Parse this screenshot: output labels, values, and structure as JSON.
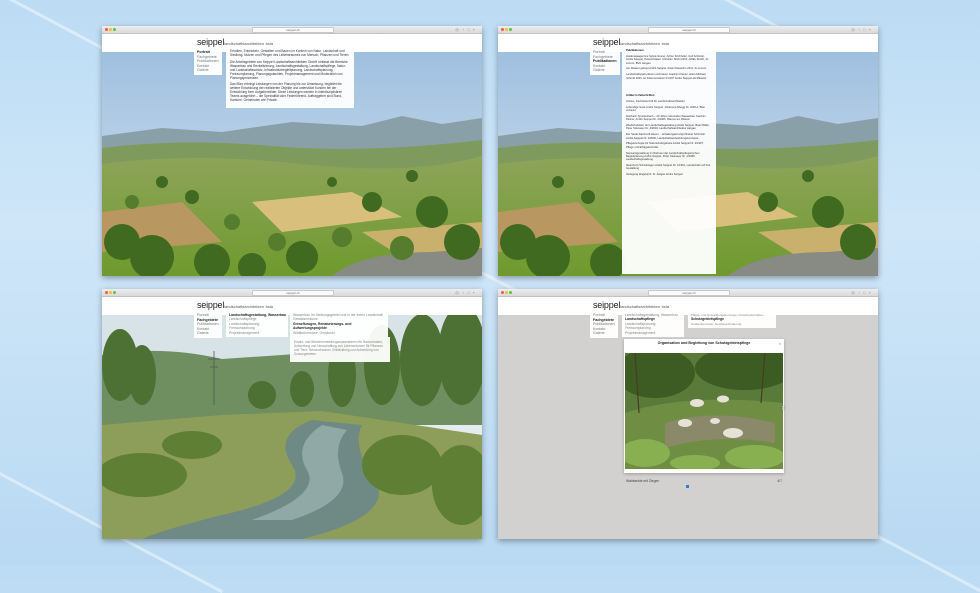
{
  "browser": {
    "url": "seippel.ch",
    "toolbar_icons": "◎ ↑ □ +",
    "nav_buttons": "‹ › ▢"
  },
  "logo": {
    "brand": "seippel",
    "name": "landschaftsarchitekten",
    "suffix": "bsla"
  },
  "nav": {
    "items": [
      "Portrait",
      "Fachgebiete",
      "Publikationen",
      "Kontakt",
      "Galerie"
    ]
  },
  "window1": {
    "paragraphs": [
      "Erhalten, Entwickeln, Gestalten und Bauen im Kontext von Natur, Landschaft und Siedlung. Nutzen und Pflegen des Lebensraumes von Mensch, Pflanzen und Tieren.",
      "Die Arbeitsgebiete von Seippel Landschaftsarchitekten GmbH umfasst die Bereiche Wasserbau und Revitalisierung, Landschaftsgestaltung, Landschaftspflege, Natur- und Landschaftsschutz, Infrastrukturbegleitplanung, Landschaftsplanung, Freiraumplanung, Planungsgutachten, Projektmanagement und Moderation von Planungsprozessen.",
      "Das Büro erbringt Leistungen von der Planung bis zur Umsetzung, begleitet die weitere Entwicklung der realisierten Objekte und unterstützt Kunden bei der Entwicklung ihrer Aufgabenbilder. Diese Leistungen werden in interdisziplinären Teams ausgeführt – die Spezialität oder Federführend, Auftraggeber sind Bund, Kantone, Gemeinden wie Private."
    ]
  },
  "window2": {
    "heading": "Publikationen",
    "entries": [
      "Heidenwaagerinne Sylvia Gruner, Arthur Kirchhofer, Ueli Schöntin, Andre Seippel, Pascal Kaiser, Christian Teicht 2014, AWEL Zürich, IH Luzern, BVU Aargau",
      "Am Wasser geboul André Seippel, Karin Passerino 2011, IH Luzern",
      "Landschaftspark planen und bauen Joachim Kleiner, Hans-Michael Schmitt 2001, so Dokumentation D 0167 André Seippel als Mitautor",
      "Artikel in Zeitschriften",
      "Anthos, Fachzeitschrift für Landschaftsarchitektur",
      "Lebendige Suse André Seippel, Johannes Albegg Nr. 3/2014, Blau verrannt",
      "Dorfbach Spreitenbach – 20 Jahre naturnaher Wasserbau Joachim Kleiner, André Seippel Nr. 2/2006, Räume am Wasser",
      "Wiederbeleben der Landschaftsgestaltung André Seippel, Beat Müller, Peter Steinauer Nr. 4/2004, Landschaftsarchitektur Aargau",
      "Der Seele bauchvoll lassen ... Erhaltungskonzept Rainer Schnitzer André Seippel Nr. 4/2000, Landschaftsentwicklungskonzepte",
      "Pflegekonzepte für Naturschutzgebiete André Seippel Nr. 2/1997, Pflege und Erfolgskontrolle",
      "Neuwertigestaltung im Rahmen der Landschaftspflegerischen Begleitplanung André Seippel, Peter Steinauer Nr. 4/1996, Landschaftsgestaltung",
      "Ideenbuch Schwitzagen André Seippel Nr. 1/1991, Landschaft und ihre Gestaltung",
      "Verlegung längsfurch: Kt. Aargau André Seippel"
    ]
  },
  "window3": {
    "fach": [
      "Landschaftsgestaltung, Wasserbau",
      "Landschaftspflege",
      "Landschaftsplanung",
      "Freiraumplanung",
      "Projektmanagement"
    ],
    "projects": [
      "Wasserbau im Siedlungsgebiet und in der freien Landschaft",
      "Gewässerräume",
      "Grenzflurugen, Renaturierungs- und Aufwertungsprojekte",
      "Wildtierkorridore, Gewässer"
    ],
    "desc": "Ersatz- und Wiederherstellungsmassnahmen für Bauvorhaben, Aufwertung und Neuschaffung von Lebensräumen für Pflanzen und Tiere, Neuausbaubau, Entwicklung und Aufwertung von Schutzgebieten"
  },
  "window4": {
    "fach": [
      "Landschaftsgestaltung, Wasserbau",
      "Landschaftspflege",
      "Landschaftsplanung",
      "Freiraumplanung",
      "Projektmanagement"
    ],
    "projects": [
      "Pflege- und Entwicklungskonzepte, Kulturlandschaften",
      "Schutzgebietspflege",
      "Grabenkonzepte, Gewässerförderung"
    ],
    "lightbox_title": "Organisation und Begleitung von Schutzgebietspflege",
    "caption": "Waldweide mit Ziegen",
    "counter": "4/7",
    "close": "×",
    "next": "›"
  },
  "colors": {
    "accent_dot": "#2f7fd0",
    "gray_bg": "#d2d1cf"
  }
}
